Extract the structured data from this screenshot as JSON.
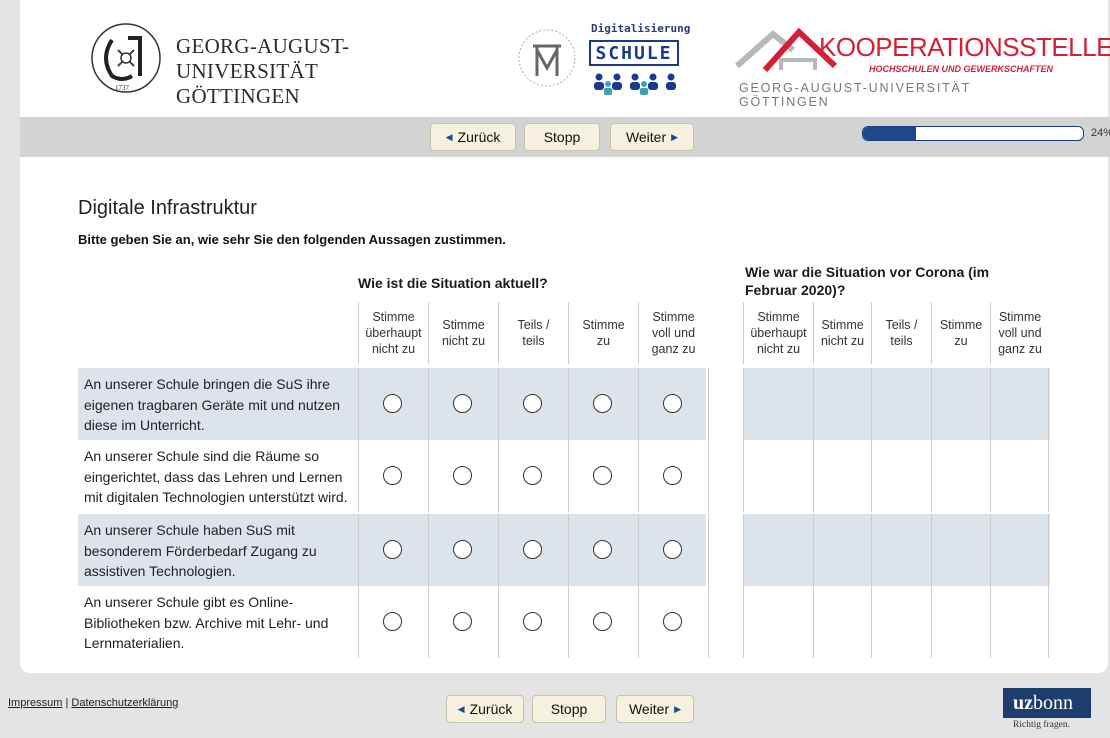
{
  "header": {
    "uni_line1": "GEORG-AUGUST-UNIVERSITÄT",
    "uni_line2": "GÖTTINGEN",
    "seal_year": "1737",
    "digital_top": "Digitalisierung",
    "digital_box": "SCHULE",
    "foundation_ring": "MAX-TRAEGER-STIFTUNG",
    "koop_title": "KOOPERATIONSSTELLE",
    "koop_sub": "HOCHSCHULEN UND GEWERKSCHAFTEN",
    "koop_uni": "GEORG-AUGUST-UNIVERSITÄT GÖTTINGEN"
  },
  "nav": {
    "back": "Zurück",
    "stop": "Stopp",
    "next": "Weiter",
    "progress_percent": 24,
    "progress_label": "24%"
  },
  "page": {
    "title": "Digitale Infrastruktur",
    "instruction": "Bitte geben Sie an, wie sehr Sie den folgenden Aussagen zustimmen."
  },
  "matrix": {
    "group_a_title": "Wie ist die Situation aktuell?",
    "group_b_title_1": "Wie war die Situation vor Corona (im",
    "group_b_title_2": "Februar 2020)?",
    "columns": [
      [
        "Stimme",
        "überhaupt",
        "nicht zu"
      ],
      [
        "Stimme",
        "nicht zu"
      ],
      [
        "Teils /",
        "teils"
      ],
      [
        "Stimme",
        "zu"
      ],
      [
        "Stimme",
        "voll und",
        "ganz zu"
      ]
    ],
    "rows": [
      {
        "line1": "An unserer Schule bringen die SuS ihre",
        "line2": "eigenen tragbaren Geräte mit und nutzen",
        "line3": "diese im Unterricht."
      },
      {
        "line1": "An unserer Schule sind die Räume so",
        "line2": "eingerichtet, dass das Lehren und Lernen",
        "line3": "mit digitalen Technologien unterstützt wird."
      },
      {
        "line1": "An unserer Schule haben SuS mit",
        "line2": "besonderem Förderbedarf Zugang zu",
        "line3": "assistiven Technologien."
      },
      {
        "line1": "An unserer Schule gibt es Online-",
        "line2": "Bibliotheken bzw. Archive mit Lehr- und",
        "line3": "Lernmaterialien."
      }
    ]
  },
  "footer": {
    "impressum": "Impressum",
    "separator": " | ",
    "privacy": "Datenschutzerklärung",
    "back": "Zurück",
    "stop": "Stopp",
    "next": "Weiter",
    "uz_bold": "uz",
    "uz_rest": "bonn",
    "uz_slogan": "Richtig fragen."
  },
  "colors": {
    "accent": "#1a4a8c",
    "band": "#dde3ea",
    "koop_red": "#d42035"
  }
}
